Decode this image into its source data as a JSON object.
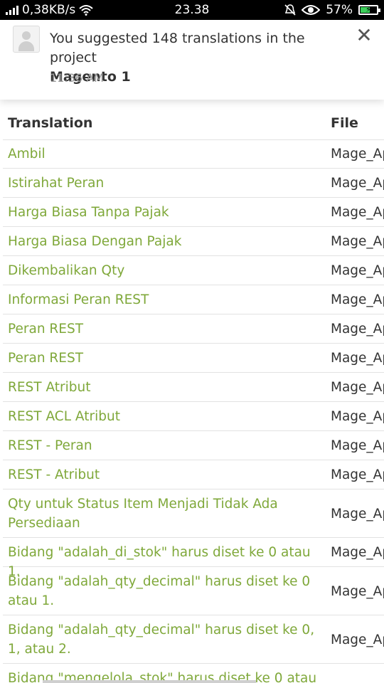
{
  "status_bar": {
    "network_speed": "0,38KB/s",
    "time": "23.38",
    "battery_percent": "57%",
    "battery_level": 0.57,
    "icons": [
      "signal-icon",
      "wifi-icon",
      "mute-bell-icon",
      "eye-icon",
      "battery-charging-icon"
    ]
  },
  "notification": {
    "message": "You suggested 148 translations in the project",
    "project": "Magento 1",
    "time": "11:36 AM",
    "close_glyph": "✕"
  },
  "table": {
    "headers": {
      "translation": "Translation",
      "file": "File"
    },
    "rows": [
      {
        "translation": "Ambil",
        "file": "Mage_Ap"
      },
      {
        "translation": "Istirahat Peran",
        "file": "Mage_Ap"
      },
      {
        "translation": "Harga Biasa Tanpa Pajak",
        "file": "Mage_Ap"
      },
      {
        "translation": "Harga Biasa Dengan Pajak",
        "file": "Mage_Ap"
      },
      {
        "translation": "Dikembalikan Qty",
        "file": "Mage_Ap"
      },
      {
        "translation": "Informasi Peran REST",
        "file": "Mage_Ap"
      },
      {
        "translation": "Peran REST",
        "file": "Mage_Ap"
      },
      {
        "translation": "Peran REST",
        "file": "Mage_Ap"
      },
      {
        "translation": "REST Atribut",
        "file": "Mage_Ap"
      },
      {
        "translation": "REST ACL Atribut",
        "file": "Mage_Ap"
      },
      {
        "translation": "REST - Peran",
        "file": "Mage_Ap"
      },
      {
        "translation": "REST - Atribut",
        "file": "Mage_Ap"
      },
      {
        "translation": "Qty untuk Status Item Menjadi Tidak Ada Persediaan",
        "file": "Mage_Ap"
      },
      {
        "translation": "Bidang \"adalah_di_stok\" harus diset ke 0 atau 1.",
        "file": "Mage_Ap"
      },
      {
        "translation": "Bidang \"adalah_qty_decimal\" harus diset ke 0 atau 1.",
        "file": "Mage_Ap"
      },
      {
        "translation": "Bidang \"adalah_qty_decimal\" harus diset ke 0, 1, atau 2.",
        "file": "Mage_Ap"
      },
      {
        "translation": "Bidang \"mengelola_stok\" harus diset ke 0 atau",
        "file": ""
      }
    ]
  }
}
